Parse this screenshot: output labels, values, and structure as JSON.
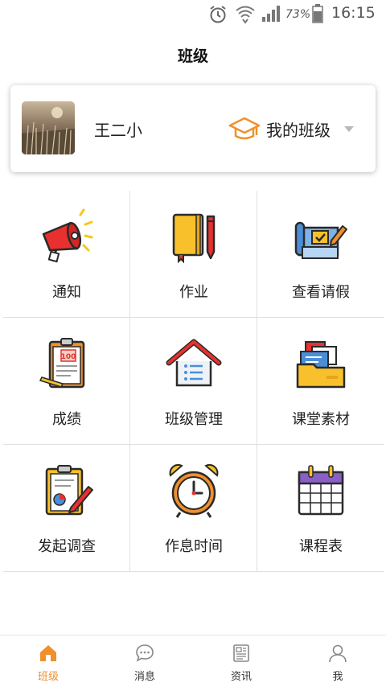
{
  "status_bar": {
    "battery_percent": "73%",
    "time": "16:15"
  },
  "header": {
    "title": "班级"
  },
  "class_card": {
    "user_name": "王二小",
    "class_selector_label": "我的班级"
  },
  "grid": {
    "items": [
      {
        "label": "通知",
        "icon": "megaphone-icon"
      },
      {
        "label": "作业",
        "icon": "notebook-pen-icon"
      },
      {
        "label": "查看请假",
        "icon": "blueprint-icon"
      },
      {
        "label": "成绩",
        "icon": "score-clipboard-icon"
      },
      {
        "label": "班级管理",
        "icon": "house-icon"
      },
      {
        "label": "课堂素材",
        "icon": "folder-icon"
      },
      {
        "label": "发起调查",
        "icon": "survey-clipboard-icon"
      },
      {
        "label": "作息时间",
        "icon": "alarm-clock-icon"
      },
      {
        "label": "课程表",
        "icon": "calendar-icon"
      }
    ]
  },
  "bottom_nav": {
    "items": [
      {
        "label": "班级",
        "icon": "home-icon",
        "active": true
      },
      {
        "label": "消息",
        "icon": "chat-bubble-icon",
        "active": false
      },
      {
        "label": "资讯",
        "icon": "newspaper-icon",
        "active": false
      },
      {
        "label": "我",
        "icon": "person-icon",
        "active": false
      }
    ]
  },
  "colors": {
    "accent": "#f0902c",
    "divider": "#e0e0e0",
    "text": "#222222"
  }
}
